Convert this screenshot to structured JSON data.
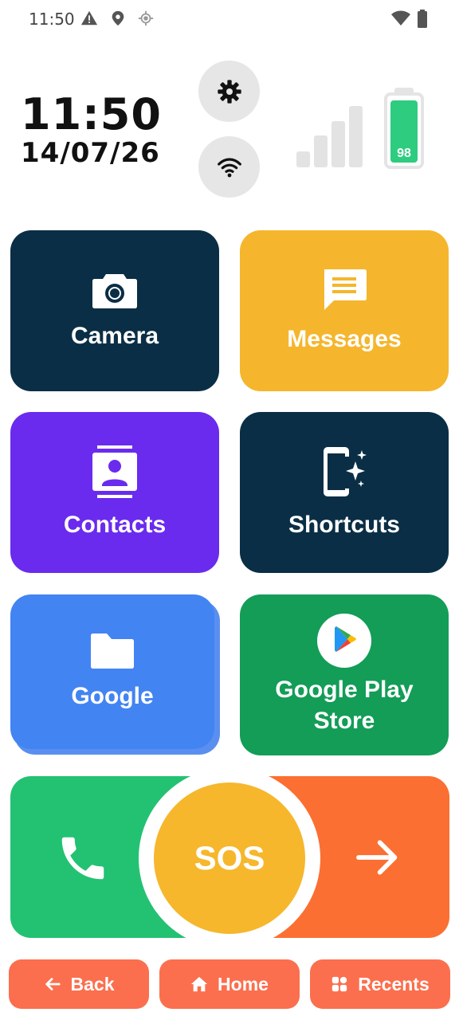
{
  "status_bar": {
    "time": "11:50",
    "icons": [
      "warning-icon",
      "location-pin-icon",
      "gps-icon",
      "wifi-icon",
      "battery-icon"
    ]
  },
  "header": {
    "clock": "11:50",
    "date": "14/07/26",
    "battery_percent": "98",
    "battery_level": 0.98,
    "signal_bars_active": 0,
    "settings_icon": "gear-icon",
    "wifi_icon": "wifi-icon"
  },
  "tiles": [
    {
      "label": "Camera",
      "icon": "camera-icon",
      "color": "#0a2e45"
    },
    {
      "label": "Messages",
      "icon": "message-icon",
      "color": "#f5b62d"
    },
    {
      "label": "Contacts",
      "icon": "contacts-icon",
      "color": "#6a2bee"
    },
    {
      "label": "Shortcuts",
      "icon": "shortcuts-icon",
      "color": "#0a2e45"
    },
    {
      "label": "Google",
      "icon": "folder-icon",
      "color": "#4384f3"
    },
    {
      "label": "Google Play Store",
      "icon": "play-store-icon",
      "color": "#139d57"
    }
  ],
  "sos": {
    "label": "SOS",
    "call_icon": "phone-icon",
    "forward_icon": "arrow-right-icon",
    "colors": {
      "left": "#22c272",
      "right": "#fb6f32",
      "center": "#f6b72c"
    }
  },
  "nav": {
    "back": "Back",
    "home": "Home",
    "recents": "Recents",
    "color": "#fb6f4e"
  }
}
